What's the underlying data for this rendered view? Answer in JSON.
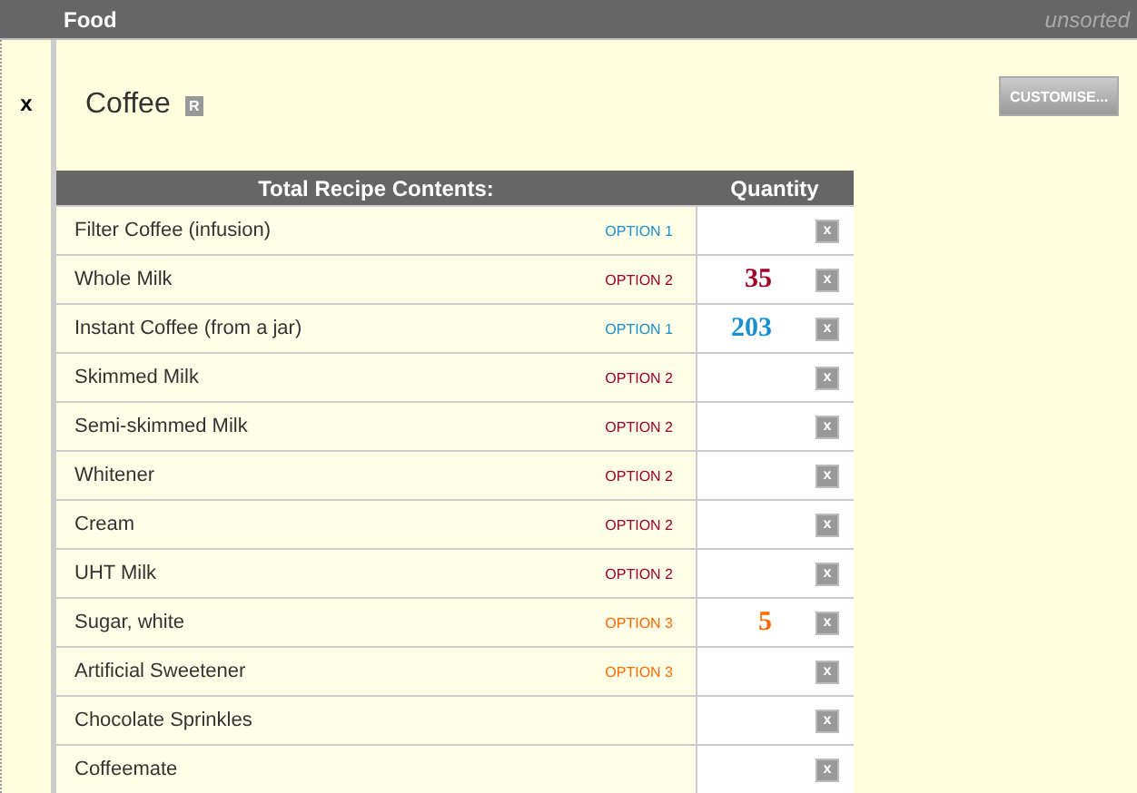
{
  "header": {
    "title": "Food",
    "sort": "unsorted"
  },
  "close": "x",
  "recipe": {
    "title": "Coffee",
    "badge": "R",
    "button": "CUSTOMISE..."
  },
  "table": {
    "columns": [
      "Total Recipe Contents:",
      "Quantity"
    ],
    "rows": [
      {
        "name": "Filter Coffee (infusion)",
        "option": "OPTION 1",
        "color": "#1a8fd0",
        "remove": "x"
      },
      {
        "name": "Whole Milk",
        "option": "OPTION 2",
        "color": "#a0002a",
        "quantity": "35",
        "remove": "x"
      },
      {
        "name": "Instant Coffee (from a jar)",
        "option": "OPTION 1",
        "color": "#1a8fd0",
        "quantity": "203",
        "remove": "x"
      },
      {
        "name": "Skimmed Milk",
        "option": "OPTION 2",
        "color": "#a0002a",
        "remove": "x"
      },
      {
        "name": "Semi-skimmed Milk",
        "option": "OPTION 2",
        "color": "#a0002a",
        "remove": "x"
      },
      {
        "name": "Whitener",
        "option": "OPTION 2",
        "color": "#a0002a",
        "remove": "x"
      },
      {
        "name": "Cream",
        "option": "OPTION 2",
        "color": "#a0002a",
        "remove": "x"
      },
      {
        "name": "UHT Milk",
        "option": "OPTION 2",
        "color": "#a0002a",
        "remove": "x"
      },
      {
        "name": "Sugar, white",
        "option": "OPTION 3",
        "color": "#ff6a00",
        "quantity": "5",
        "remove": "x"
      },
      {
        "name": "Artificial Sweetener",
        "option": "OPTION 3",
        "color": "#ff6a00",
        "remove": "x"
      },
      {
        "name": "Chocolate Sprinkles",
        "remove": "x"
      },
      {
        "name": "Coffeemate",
        "remove": "x"
      }
    ]
  }
}
